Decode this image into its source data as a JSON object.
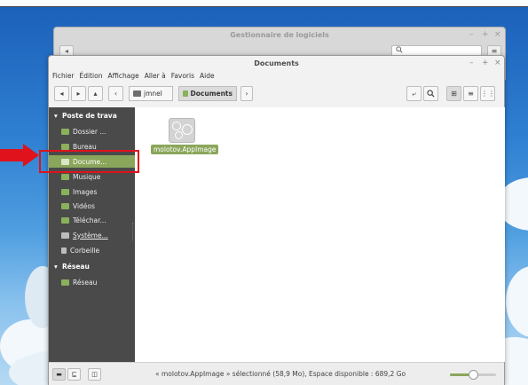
{
  "background_window": {
    "title": "Gestionnaire de logiciels",
    "search_icon": "search-icon",
    "menu_icon": "hamburger-icon"
  },
  "window": {
    "title": "Documents",
    "minimize": "–",
    "maximize": "+",
    "close": "×"
  },
  "menubar": [
    "Fichier",
    "Édition",
    "Affichage",
    "Aller à",
    "Favoris",
    "Aide"
  ],
  "toolbar": {
    "back": "◂",
    "forward": "▸",
    "up": "▴",
    "toggle_location": "‹",
    "crumbs": [
      "jmnel",
      "Documents"
    ],
    "next_crumb": "›",
    "open_terminal": "⤶",
    "search": "⚲",
    "view_icons": "⊞",
    "view_list": "≡",
    "view_compact": "⋮⋮"
  },
  "sidebar": {
    "places_header": "Poste de trava",
    "places": [
      {
        "label": "Dossier ...",
        "icon": "folder-icon"
      },
      {
        "label": "Bureau",
        "icon": "desktop-folder-icon"
      },
      {
        "label": "Docume...",
        "icon": "documents-folder-icon",
        "selected": true
      },
      {
        "label": "Musique",
        "icon": "music-folder-icon"
      },
      {
        "label": "Images",
        "icon": "pictures-folder-icon"
      },
      {
        "label": "Vidéos",
        "icon": "videos-folder-icon"
      },
      {
        "label": "Téléchar...",
        "icon": "downloads-folder-icon"
      },
      {
        "label": "Système...",
        "icon": "drive-icon"
      },
      {
        "label": "Corbeille",
        "icon": "trash-icon"
      }
    ],
    "network_header": "Réseau",
    "network": [
      {
        "label": "Réseau",
        "icon": "network-icon"
      }
    ]
  },
  "files": [
    {
      "name": "molotov.AppImage",
      "icon": "appimage-file-icon",
      "selected": true
    }
  ],
  "statusbar": {
    "text": "« molotov.AppImage » sélectionné (58,9 Mo), Espace disponible : 689,2 Go",
    "zoom_level": 0.5
  }
}
